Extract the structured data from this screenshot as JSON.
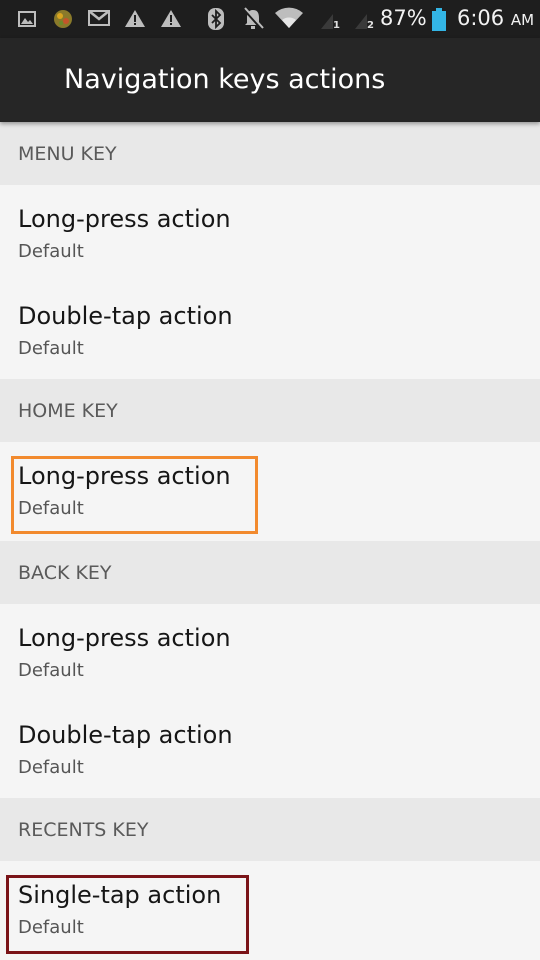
{
  "status_bar": {
    "icons": [
      "image-icon",
      "app-icon",
      "gmail-icon",
      "warning-icon",
      "warning-icon",
      "bluetooth-icon",
      "notifications-off-icon",
      "wifi-icon",
      "signal-icon",
      "signal-icon"
    ],
    "sim1": "1",
    "sim2": "2",
    "battery": "87%",
    "time": "6:06",
    "ampm": "AM"
  },
  "app_bar": {
    "title": "Navigation keys actions"
  },
  "sections": [
    {
      "header": "MENU KEY",
      "items": [
        {
          "title": "Long-press action",
          "summary": "Default"
        },
        {
          "title": "Double-tap action",
          "summary": "Default"
        }
      ]
    },
    {
      "header": "HOME KEY",
      "items": [
        {
          "title": "Long-press action",
          "summary": "Default"
        }
      ]
    },
    {
      "header": "BACK KEY",
      "items": [
        {
          "title": "Long-press action",
          "summary": "Default"
        },
        {
          "title": "Double-tap action",
          "summary": "Default"
        }
      ]
    },
    {
      "header": "RECENTS KEY",
      "items": [
        {
          "title": "Single-tap action",
          "summary": "Default"
        }
      ]
    }
  ],
  "colors": {
    "status_bar_bg": "#1e1e1e",
    "app_bar_bg": "#262626",
    "section_bg": "#e8e8e8",
    "item_bg": "#f5f5f5",
    "highlight_orange": "#f28a2e",
    "highlight_red": "#7a1418",
    "battery": "#33b5e5"
  }
}
